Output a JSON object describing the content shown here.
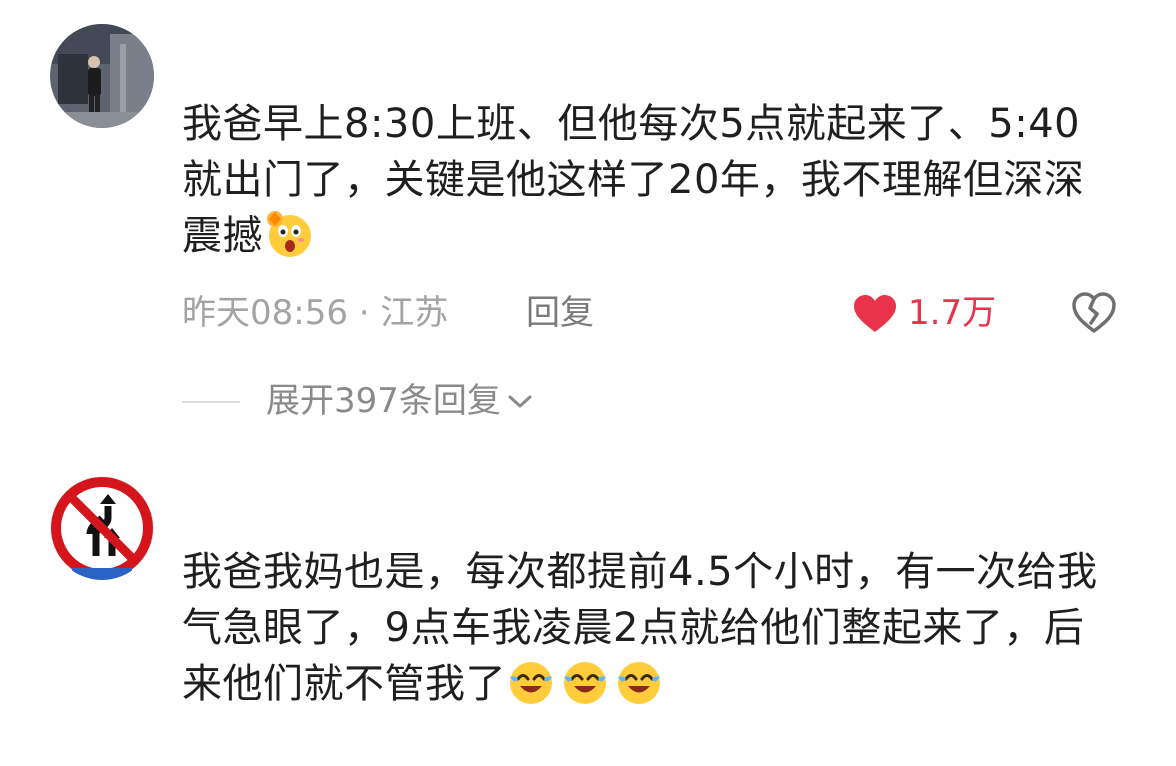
{
  "comments": [
    {
      "text": "我爸早上8:30上班、但他每次5点就起来了、5:40就出门了，关键是他这样了20年，我不理解但深深震撼",
      "emojis": [
        "astonished-emoji"
      ],
      "time": "昨天08:56",
      "location": "江苏",
      "meta_separator": "·",
      "reply_label": "回复",
      "like_count": "1.7万",
      "liked": true,
      "expand_label": "展开397条回复"
    },
    {
      "text": "我爸我妈也是，每次都提前4.5个小时，有一次给我气急眼了，9点车我凌晨2点就给他们整起来了，后来他们就不管我了",
      "emojis": [
        "crying-laughing-emoji",
        "crying-laughing-emoji",
        "crying-laughing-emoji"
      ]
    }
  ],
  "colors": {
    "like": "#e8334a",
    "meta": "#a3a3a3",
    "text": "#1f1f1f"
  }
}
